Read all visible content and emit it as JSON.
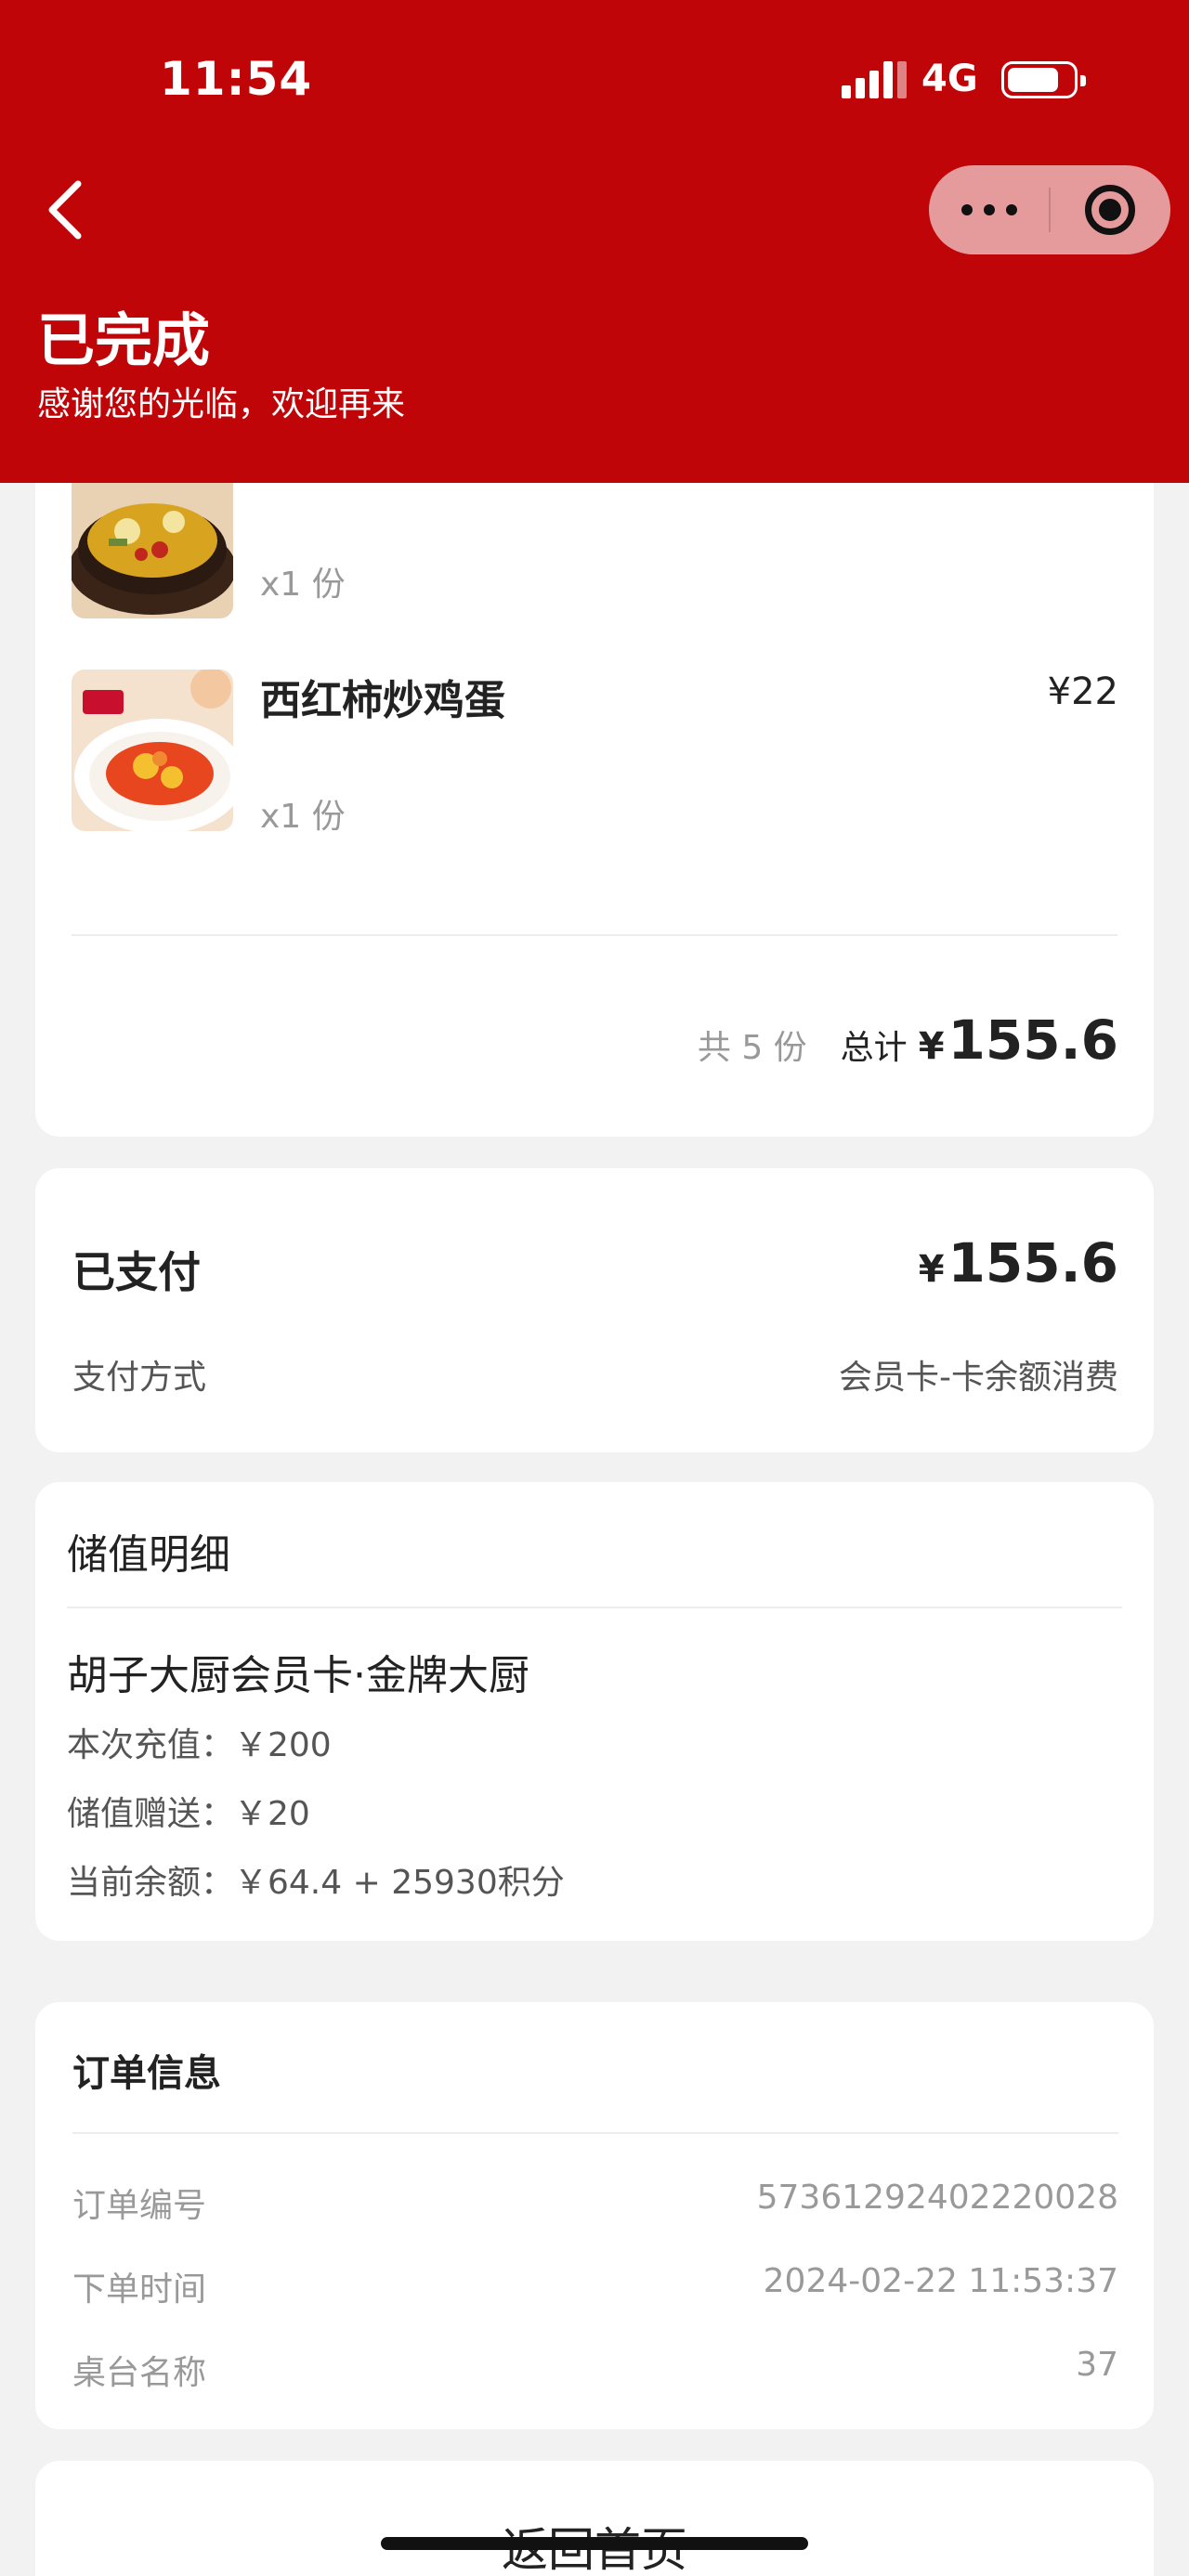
{
  "status_bar": {
    "time": "11:54",
    "network": "4G",
    "battery_level": 0.8
  },
  "header": {
    "title": "已完成",
    "subtitle": "感谢您的光临，欢迎再来",
    "background_color": "#bf0508",
    "back_icon": "chevron-left-icon",
    "capsule_icons": [
      "more-dots-icon",
      "target-close-icon"
    ]
  },
  "order_items": [
    {
      "name": "",
      "qty": "x1 份",
      "price": ""
    },
    {
      "name": "西红柿炒鸡蛋",
      "qty": "x1 份",
      "price": "¥22"
    }
  ],
  "order_summary": {
    "count": "共 5 份",
    "total_label": "总计",
    "currency": "¥",
    "total": "155.6"
  },
  "payment": {
    "title": "已支付",
    "currency": "¥",
    "amount": "155.6",
    "method_label": "支付方式",
    "method_value": "会员卡-卡余额消费"
  },
  "stored_value": {
    "title": "储值明细",
    "card_name": "胡子大厨会员卡·金牌大厨",
    "recharge": "本次充值：￥200",
    "bonus": "储值赠送：￥20",
    "balance": "当前余额：￥64.4 + 25930积分"
  },
  "order_info": {
    "title": "订单信息",
    "rows": [
      {
        "label": "订单编号",
        "value": "57361292402220028"
      },
      {
        "label": "下单时间",
        "value": "2024-02-22 11:53:37"
      },
      {
        "label": "桌台名称",
        "value": "37"
      }
    ]
  },
  "footer": {
    "home_button": "返回首页"
  }
}
